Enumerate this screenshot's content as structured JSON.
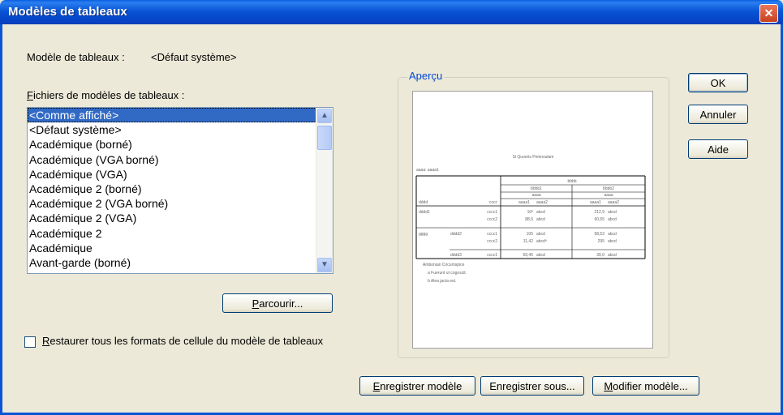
{
  "window": {
    "title": "Modèles de tableaux",
    "close_glyph": "✕"
  },
  "template_label": "Modèle de tableaux :",
  "template_value": "<Défaut système>",
  "files_label": "Fichiers de modèles de tableaux :",
  "files": [
    "<Comme affiché>",
    "<Défaut système>",
    "Académique (borné)",
    "Académique (VGA borné)",
    "Académique (VGA)",
    "Académique 2 (borné)",
    "Académique 2 (VGA borné)",
    "Académique 2 (VGA)",
    "Académique 2",
    "Académique",
    "Avant-garde (borné)"
  ],
  "selected_index": 0,
  "browse_button": "Parcourir...",
  "restore_checkbox": {
    "label": "Restaurer tous les formats de cellule du modèle de tableaux",
    "checked": false
  },
  "preview": {
    "label": "Aperçu",
    "table_title": "Si Quoeris Peninsulam",
    "layer_label": "aaaa: aaaa1",
    "col_header_top": "bbbb",
    "col_header_b1": "bbbb1",
    "col_header_b2": "bbbb2",
    "col_header_sub": "aaaa",
    "row_dim1": "dddd",
    "row_dim2": "cccc",
    "col_labels": [
      "aaaa1",
      "aaaa2",
      "aaaa1",
      "aaaa2"
    ],
    "rows": [
      {
        "g1": "dddd1",
        "g2": "",
        "c": "cccc1",
        "v": [
          "10ª",
          "abcd",
          "212,9",
          "abcd"
        ]
      },
      {
        "g1": "",
        "g2": "",
        "c": "cccc2",
        "v": [
          "88,6",
          "abcd",
          "60,65",
          "abcd"
        ]
      },
      {
        "g1": "gggg",
        "g2": "dddd2",
        "c": "cccc1",
        "v": [
          "105",
          "abcd",
          "58,53",
          "abcd"
        ]
      },
      {
        "g1": "",
        "g2": "",
        "c": "cccc2",
        "v": [
          "11,42",
          "abcdª",
          "295",
          "abcd"
        ]
      },
      {
        "g1": "",
        "g2": "dddd3",
        "c": "cccc1",
        "v": [
          "69,45",
          "abcd",
          "30,0",
          "abcd"
        ]
      }
    ],
    "footnotes": [
      "Ambonian Circumspice",
      "a  Fuerunt ut cogoscit.",
      "b  Alea jacta est."
    ]
  },
  "buttons": {
    "ok": "OK",
    "cancel": "Annuler",
    "help": "Aide",
    "save": "Enregistrer modèle",
    "save_as": "Enregistrer sous...",
    "edit": "Modifier modèle..."
  }
}
